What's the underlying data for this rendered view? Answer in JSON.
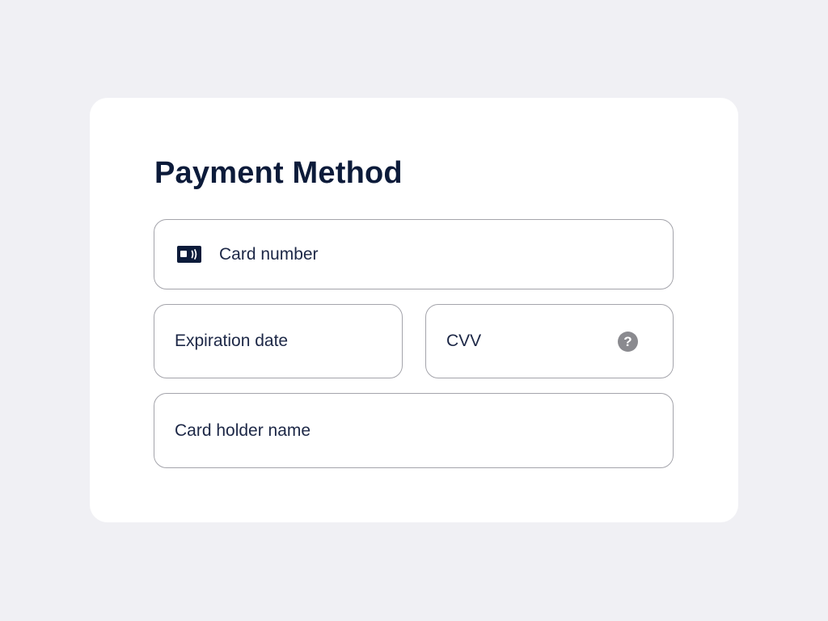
{
  "form": {
    "title": "Payment Method",
    "fields": {
      "card_number": {
        "placeholder": "Card number",
        "value": "",
        "icon": "credit-card-icon"
      },
      "expiration_date": {
        "placeholder": "Expiration date",
        "value": ""
      },
      "cvv": {
        "placeholder": "CVV",
        "value": "",
        "help_icon": "question-mark-icon",
        "help_glyph": "?"
      },
      "card_holder_name": {
        "placeholder": "Card holder name",
        "value": ""
      }
    }
  },
  "colors": {
    "page_background": "#f0f0f4",
    "card_background": "#ffffff",
    "title_text": "#0c1b3a",
    "field_border": "#a4a4ab",
    "help_icon_fill": "#8a8a8f"
  }
}
